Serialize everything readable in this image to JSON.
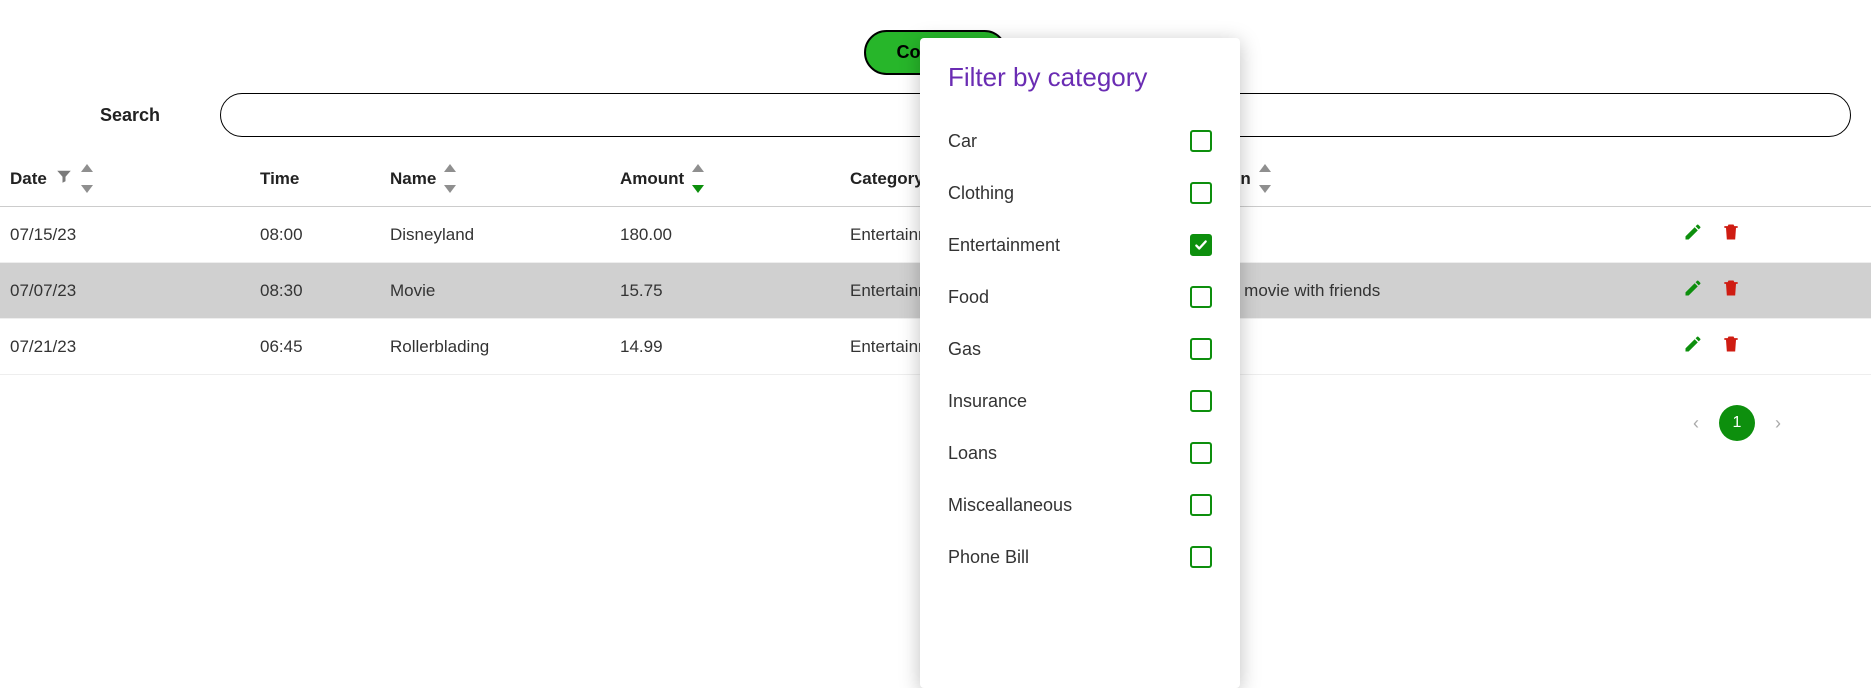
{
  "header": {
    "compare_label": "Compare"
  },
  "search": {
    "label": "Search",
    "value": ""
  },
  "columns": {
    "date": "Date",
    "time": "Time",
    "name": "Name",
    "amount": "Amount",
    "category": "Category",
    "description": "Description"
  },
  "sort": {
    "active_column": "amount",
    "direction": "desc"
  },
  "rows": [
    {
      "date": "07/15/23",
      "time": "08:00",
      "name": "Disneyland",
      "amount": "180.00",
      "category": "Entertainment",
      "description": ""
    },
    {
      "date": "07/07/23",
      "time": "08:30",
      "name": "Movie",
      "amount": "15.75",
      "category": "Entertainment",
      "description": "e movie with friends"
    },
    {
      "date": "07/21/23",
      "time": "06:45",
      "name": "Rollerblading",
      "amount": "14.99",
      "category": "Entertainment",
      "description": ""
    }
  ],
  "pagination": {
    "current": "1"
  },
  "filter_popover": {
    "title": "Filter by category",
    "options": [
      {
        "label": "Car",
        "checked": false
      },
      {
        "label": "Clothing",
        "checked": false
      },
      {
        "label": "Entertainment",
        "checked": true
      },
      {
        "label": "Food",
        "checked": false
      },
      {
        "label": "Gas",
        "checked": false
      },
      {
        "label": "Insurance",
        "checked": false
      },
      {
        "label": "Loans",
        "checked": false
      },
      {
        "label": "Misceallaneous",
        "checked": false
      },
      {
        "label": "Phone Bill",
        "checked": false
      }
    ]
  }
}
